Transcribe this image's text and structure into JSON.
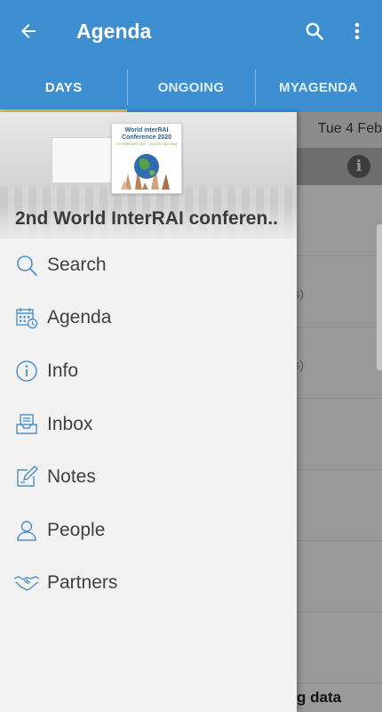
{
  "appbar": {
    "title": "Agenda",
    "icons": [
      "back-arrow-icon",
      "search-icon",
      "more-vert-icon"
    ]
  },
  "tabs": [
    {
      "label": "DAYS",
      "active": true
    },
    {
      "label": "ONGOING",
      "active": false
    },
    {
      "label": "MYAGENDA",
      "active": false
    }
  ],
  "background": {
    "date_label": "Tue 4 Feb",
    "row_text_1": "s)",
    "row_text_2": "s)",
    "bottom_text": "g data"
  },
  "drawer": {
    "logo": {
      "line1": "World interRAI",
      "line2": "Conference 2020",
      "line3": "3-4 FEBRUARY 2020 · LEUVEN, BELGIUM"
    },
    "title": "2nd World InterRAI conferen..",
    "items": [
      {
        "label": "Search",
        "icon": "search-icon"
      },
      {
        "label": "Agenda",
        "icon": "calendar-icon"
      },
      {
        "label": "Info",
        "icon": "info-icon"
      },
      {
        "label": "Inbox",
        "icon": "inbox-icon"
      },
      {
        "label": "Notes",
        "icon": "notes-icon"
      },
      {
        "label": "People",
        "icon": "person-icon"
      },
      {
        "label": "Partners",
        "icon": "handshake-icon"
      }
    ]
  },
  "colors": {
    "primary": "#3d8fd1",
    "tab_indicator": "#f0b848",
    "icon_blue": "#4a90cc",
    "drawer_bg": "#f2f2f2"
  }
}
